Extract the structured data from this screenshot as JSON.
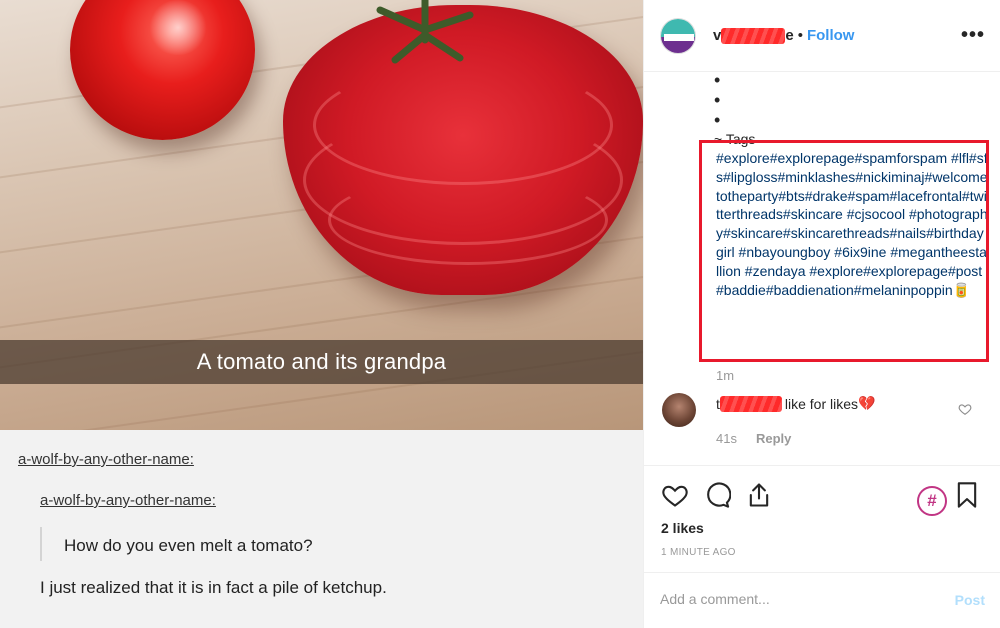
{
  "photo": {
    "caption": "A tomato and its grandpa",
    "tumblr": {
      "user_1": "a-wolf-by-any-other-name:",
      "user_2": "a-wolf-by-any-other-name:",
      "question": "How do you even melt a tomato?",
      "answer": "I just realized that it is in fact a pile of ketchup."
    }
  },
  "header": {
    "username_start": "v",
    "username_end": "e",
    "separator": "•",
    "follow_label": "Follow",
    "more_icon": "ellipsis-icon",
    "more_label": "•••"
  },
  "post": {
    "dots": [
      "•",
      "•",
      "•"
    ],
    "tags_label": "~ Tags",
    "hashtags": "#explore#explorepage#spamforspam #lfl#sfs#lipgloss#minklashes#nickiminaj#welcometotheparty#bts#drake#spam#lacefrontal#twitterthreads#skincare #cjsocool #photography#skincare#skincarethreads#nails#birthdaygirl #nbayoungboy #6ix9ine #megantheestallion #zendaya #explore#explorepage#post#baddie#baddienation#melaninpoppin",
    "ketchup_emoji": "🥫",
    "time": "1m"
  },
  "comment": {
    "username_start": "t",
    "text": "like for likes",
    "heart_emoji": "💔",
    "time": "41s",
    "reply_label": "Reply"
  },
  "actions": {
    "likes": "2 likes",
    "time_ago": "1 MINUTE AGO",
    "hashtag_badge": "#"
  },
  "add_comment": {
    "placeholder": "Add a comment...",
    "post_label": "Post"
  },
  "colors": {
    "link_blue": "#3897f0",
    "hashtag_blue": "#003569",
    "highlight_red": "#e8192c",
    "post_disabled": "#b2dffc"
  }
}
